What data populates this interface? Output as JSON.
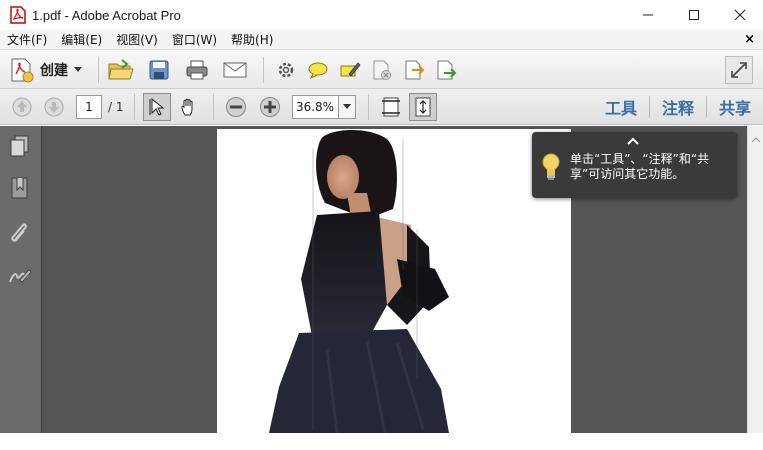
{
  "window": {
    "title": "1.pdf - Adobe Acrobat Pro",
    "minimize_glyph": "—",
    "maximize_glyph": "☐",
    "close_glyph": "✕"
  },
  "menu": {
    "items": [
      "文件(F)",
      "编辑(E)",
      "视图(V)",
      "窗口(W)",
      "帮助(H)"
    ],
    "close_glyph": "×"
  },
  "toolbar": {
    "create_label": "创建",
    "icons": [
      "create-pdf-icon",
      "open-folder-icon",
      "save-icon",
      "print-icon",
      "email-icon",
      "gear-icon",
      "comment-bubble-icon",
      "sign-pen-icon",
      "secure-icon",
      "export-icon",
      "share-icon",
      "expand-icon"
    ]
  },
  "nav_toolbar": {
    "page_current": "1",
    "page_total": "/ 1",
    "zoom_value": "36.8%",
    "right_tabs": [
      "工具",
      "注释",
      "共享"
    ]
  },
  "tooltip": {
    "text": "单击“工具”、“注释”和“共享”可访问其它功能。"
  },
  "colors": {
    "accent": "#3b6ea5",
    "doc_bg": "#555555",
    "nav_bg": "#6b6b6b",
    "tooltip_bg": "#3a3a3a"
  }
}
